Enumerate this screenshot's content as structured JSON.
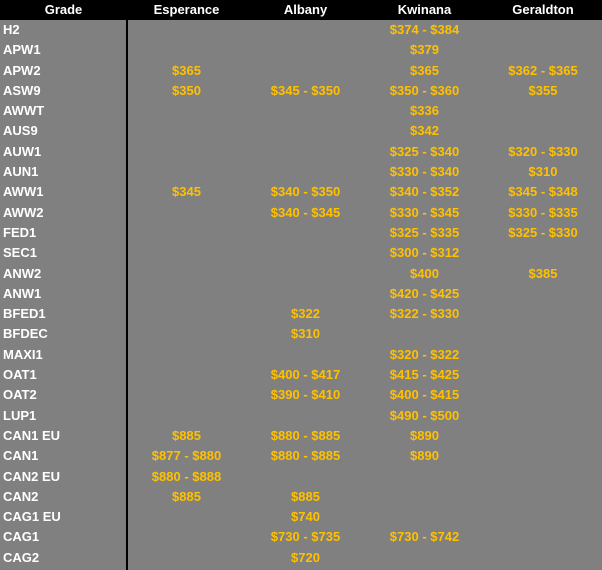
{
  "header": {
    "grade": "Grade",
    "esperance": "Esperance",
    "albany": "Albany",
    "kwinana": "Kwinana",
    "geraldton": "Geraldton"
  },
  "rows": [
    {
      "grade": "H2",
      "esperance": "",
      "albany": "",
      "kwinana": "$374 - $384",
      "geraldton": ""
    },
    {
      "grade": "APW1",
      "esperance": "",
      "albany": "",
      "kwinana": "$379",
      "geraldton": ""
    },
    {
      "grade": "APW2",
      "esperance": "$365",
      "albany": "",
      "kwinana": "$365",
      "geraldton": "$362 - $365"
    },
    {
      "grade": "ASW9",
      "esperance": "$350",
      "albany": "$345 - $350",
      "kwinana": "$350 - $360",
      "geraldton": "$355"
    },
    {
      "grade": "AWWT",
      "esperance": "",
      "albany": "",
      "kwinana": "$336",
      "geraldton": ""
    },
    {
      "grade": "AUS9",
      "esperance": "",
      "albany": "",
      "kwinana": "$342",
      "geraldton": ""
    },
    {
      "grade": "AUW1",
      "esperance": "",
      "albany": "",
      "kwinana": "$325 - $340",
      "geraldton": "$320 - $330"
    },
    {
      "grade": "AUN1",
      "esperance": "",
      "albany": "",
      "kwinana": "$330 - $340",
      "geraldton": "$310"
    },
    {
      "grade": "AWW1",
      "esperance": "$345",
      "albany": "$340 - $350",
      "kwinana": "$340 - $352",
      "geraldton": "$345 - $348"
    },
    {
      "grade": "AWW2",
      "esperance": "",
      "albany": "$340 - $345",
      "kwinana": "$330 - $345",
      "geraldton": "$330 - $335"
    },
    {
      "grade": "FED1",
      "esperance": "",
      "albany": "",
      "kwinana": "$325 - $335",
      "geraldton": "$325 - $330"
    },
    {
      "grade": "SEC1",
      "esperance": "",
      "albany": "",
      "kwinana": "$300 - $312",
      "geraldton": ""
    },
    {
      "grade": "ANW2",
      "esperance": "",
      "albany": "",
      "kwinana": "$400",
      "geraldton": "$385"
    },
    {
      "grade": "ANW1",
      "esperance": "",
      "albany": "",
      "kwinana": "$420 - $425",
      "geraldton": ""
    },
    {
      "grade": "BFED1",
      "esperance": "",
      "albany": "$322",
      "kwinana": "$322 - $330",
      "geraldton": ""
    },
    {
      "grade": "BFDEC",
      "esperance": "",
      "albany": "$310",
      "kwinana": "",
      "geraldton": ""
    },
    {
      "grade": "MAXI1",
      "esperance": "",
      "albany": "",
      "kwinana": "$320 - $322",
      "geraldton": ""
    },
    {
      "grade": "OAT1",
      "esperance": "",
      "albany": "$400 - $417",
      "kwinana": "$415 - $425",
      "geraldton": ""
    },
    {
      "grade": "OAT2",
      "esperance": "",
      "albany": "$390 - $410",
      "kwinana": "$400 - $415",
      "geraldton": ""
    },
    {
      "grade": "LUP1",
      "esperance": "",
      "albany": "",
      "kwinana": "$490 - $500",
      "geraldton": ""
    },
    {
      "grade": "CAN1 EU",
      "esperance": "$885",
      "albany": "$880 - $885",
      "kwinana": "$890",
      "geraldton": ""
    },
    {
      "grade": "CAN1",
      "esperance": "$877 - $880",
      "albany": "$880 - $885",
      "kwinana": "$890",
      "geraldton": ""
    },
    {
      "grade": "CAN2 EU",
      "esperance": "$880 - $888",
      "albany": "",
      "kwinana": "",
      "geraldton": ""
    },
    {
      "grade": "CAN2",
      "esperance": "$885",
      "albany": "$885",
      "kwinana": "",
      "geraldton": ""
    },
    {
      "grade": "CAG1 EU",
      "esperance": "",
      "albany": "$740",
      "kwinana": "",
      "geraldton": ""
    },
    {
      "grade": "CAG1",
      "esperance": "",
      "albany": "$730 - $735",
      "kwinana": "$730 - $742",
      "geraldton": ""
    },
    {
      "grade": "CAG2",
      "esperance": "",
      "albany": "$720",
      "kwinana": "",
      "geraldton": ""
    }
  ],
  "colors": {
    "background": "#808080",
    "header_bg": "#000000",
    "header_text": "#ffffff",
    "grade_text": "#ffffff",
    "price_text": "#ffc000"
  }
}
